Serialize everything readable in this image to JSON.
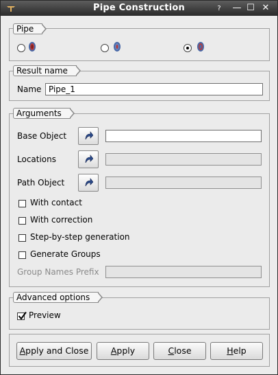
{
  "window": {
    "title": "Pipe Construction",
    "help_glyph": "?",
    "minimize_glyph": "—",
    "maximize_glyph": "☐",
    "close_glyph": "✕"
  },
  "pipe": {
    "label": "Pipe",
    "options": [
      {
        "checked": false
      },
      {
        "checked": false
      },
      {
        "checked": true
      }
    ]
  },
  "result": {
    "group_label": "Result name",
    "name_label": "Name",
    "name_value": "Pipe_1"
  },
  "arguments": {
    "group_label": "Arguments",
    "base_object_label": "Base Object",
    "locations_label": "Locations",
    "path_object_label": "Path Object",
    "with_contact_label": "With contact",
    "with_correction_label": "With correction",
    "step_by_step_label": "Step-by-step generation",
    "generate_groups_label": "Generate Groups",
    "group_names_prefix_label": "Group Names Prefix",
    "with_contact": false,
    "with_correction": false,
    "step_by_step": false,
    "generate_groups": false
  },
  "advanced": {
    "group_label": "Advanced options",
    "preview_label": "Preview",
    "preview": true
  },
  "buttons": {
    "apply_close_first": "A",
    "apply_close_rest": "pply and Close",
    "apply_first": "A",
    "apply_rest": "pply",
    "close_first": "C",
    "close_rest": "lose",
    "help_first": "H",
    "help_rest": "elp"
  },
  "colors": {
    "titlebar": "#2a2a2a",
    "accent_arrow": "#2b4b8a"
  }
}
